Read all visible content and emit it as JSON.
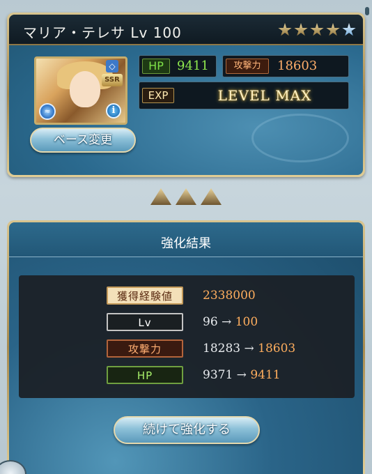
{
  "character": {
    "name": "マリア・テレサ",
    "level_text": "Lv 100",
    "rarity": "SSR",
    "stars_filled": 4,
    "stars_blue": 1,
    "hp_label": "HP",
    "hp_value": "9411",
    "atk_label": "攻撃力",
    "atk_value": "18603",
    "exp_label": "EXP",
    "exp_status": "LEVEL MAX",
    "base_change_label": "ベース変更"
  },
  "result": {
    "title": "強化結果",
    "rows": [
      {
        "label": "獲得経験値",
        "before": "",
        "after": "2338000"
      },
      {
        "label": "Lv",
        "before": "96",
        "arrow": "→",
        "after": "100"
      },
      {
        "label": "攻撃力",
        "before": "18283",
        "arrow": "→",
        "after": "18603"
      },
      {
        "label": "HP",
        "before": "9371",
        "arrow": "→",
        "after": "9411"
      }
    ],
    "continue_label": "続けて強化する"
  },
  "colors": {
    "hp": "#8fe94e",
    "atk": "#ffae6a",
    "accent_gold": "#c7ad6b",
    "panel_blue": "#2b6a8f"
  }
}
